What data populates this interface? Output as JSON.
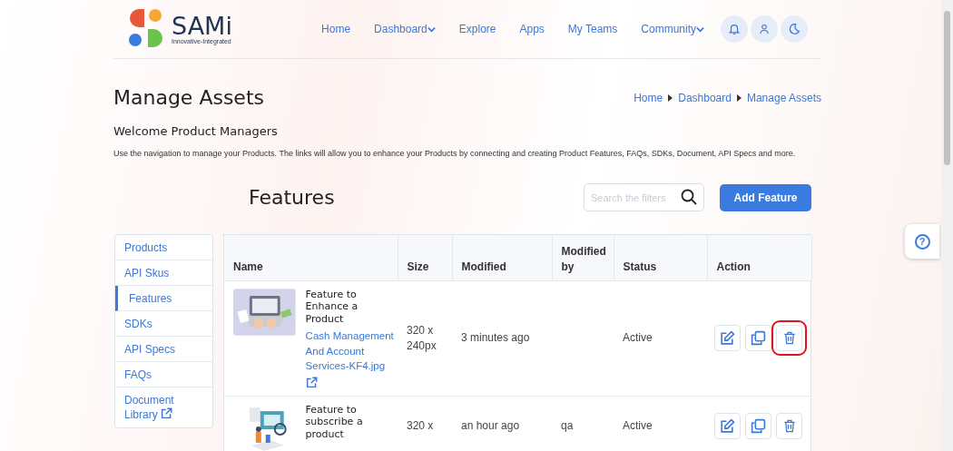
{
  "header": {
    "logo_text": "SAMi",
    "logo_tagline": "Innovative-Integrated",
    "nav": [
      {
        "label": "Home",
        "dropdown": false
      },
      {
        "label": "Dashboard",
        "dropdown": true
      },
      {
        "label": "Explore",
        "dropdown": false
      },
      {
        "label": "Apps",
        "dropdown": false
      },
      {
        "label": "My Teams",
        "dropdown": false
      },
      {
        "label": "Community",
        "dropdown": true
      }
    ],
    "icon_buttons": [
      {
        "kind": "bell"
      },
      {
        "kind": "user"
      },
      {
        "kind": "moon"
      }
    ]
  },
  "page": {
    "title": "Manage Assets",
    "breadcrumb": [
      "Home",
      "Dashboard",
      "Manage Assets"
    ],
    "welcome": "Welcome Product Managers",
    "description": "Use the navigation to manage your Products. The links will allow you to enhance your Products by connecting and creating Product Features, FAQs, SDKs, Document, API Specs and more."
  },
  "features": {
    "title": "Features",
    "search": {
      "placeholder": "Search the filters"
    },
    "add_button": "Add Feature"
  },
  "sidebar": {
    "items": [
      {
        "label": "Products",
        "selected": false,
        "external": false
      },
      {
        "label": "API Skus",
        "selected": false,
        "external": false
      },
      {
        "label": "Features",
        "selected": true,
        "external": false
      },
      {
        "label": "SDKs",
        "selected": false,
        "external": false
      },
      {
        "label": "API Specs",
        "selected": false,
        "external": false
      },
      {
        "label": "FAQs",
        "selected": false,
        "external": false
      },
      {
        "label": "Document Library",
        "selected": false,
        "external": true
      }
    ]
  },
  "table": {
    "columns": [
      "Name",
      "Size",
      "Modified",
      "Modified by",
      "Status",
      "Action"
    ],
    "rows": [
      {
        "name": "Feature to Enhance a Product",
        "file_link": "Cash Management And Account Services-KF4.jpg",
        "size": "320 x 240px",
        "modified": "3 minutes ago",
        "status": "Active",
        "actions": [
          {
            "kind": "edit",
            "highlighted": false
          },
          {
            "kind": "copy",
            "highlighted": false
          },
          {
            "kind": "delete",
            "highlighted": true
          }
        ]
      },
      {
        "name": "Feature to subscribe a product",
        "size": "320 x",
        "modified": "an hour ago",
        "modified_by": "qa",
        "status": "Active",
        "actions": [
          {
            "kind": "edit",
            "highlighted": false
          },
          {
            "kind": "copy",
            "highlighted": false
          },
          {
            "kind": "delete",
            "highlighted": false
          }
        ]
      }
    ]
  },
  "help_button": {
    "label": "?"
  }
}
